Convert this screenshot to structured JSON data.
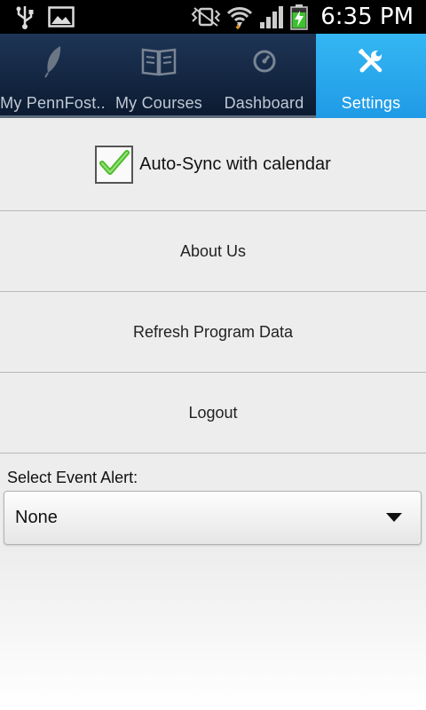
{
  "status_bar": {
    "time": "6:35 PM",
    "icons": [
      "usb-icon",
      "image-icon",
      "vibrate-icon",
      "wifi-icon",
      "signal-icon",
      "battery-charging-icon"
    ]
  },
  "tabs": [
    {
      "label": "My PennFost..",
      "icon": "feather-icon",
      "active": false
    },
    {
      "label": "My Courses",
      "icon": "book-icon",
      "active": false
    },
    {
      "label": "Dashboard",
      "icon": "speedometer-icon",
      "active": false
    },
    {
      "label": "Settings",
      "icon": "tools-icon",
      "active": true
    }
  ],
  "settings": {
    "auto_sync_label": "Auto-Sync with calendar",
    "auto_sync_checked": true,
    "menu": [
      {
        "label": "About Us"
      },
      {
        "label": "Refresh Program Data"
      },
      {
        "label": "Logout"
      }
    ],
    "event_alert_label": "Select Event Alert:",
    "event_alert_value": "None"
  },
  "colors": {
    "active_tab": "#29a9ee",
    "tab_bar": "#14253f",
    "checkmark": "#5cc83b"
  }
}
